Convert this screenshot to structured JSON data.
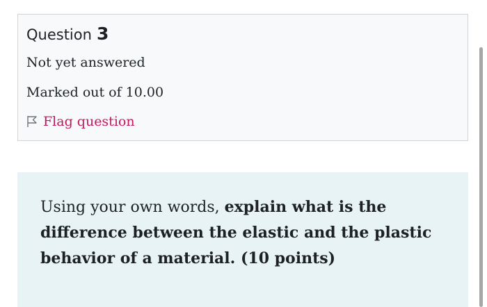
{
  "question": {
    "word": "Question",
    "number": "3",
    "status": "Not yet answered",
    "marks": "Marked out of 10.00",
    "flag_label": "Flag question",
    "flag_icon": "flag-icon"
  },
  "prompt": {
    "lead": "Using your own words, ",
    "bold": "explain what is the difference between the elastic and the plastic behavior of a material. (10 points)"
  },
  "colors": {
    "info_background": "#f8f9fa",
    "info_border": "#cfd4d9",
    "question_background": "#e7f3f5",
    "flag_link": "#c2185b",
    "text": "#1d2125"
  }
}
